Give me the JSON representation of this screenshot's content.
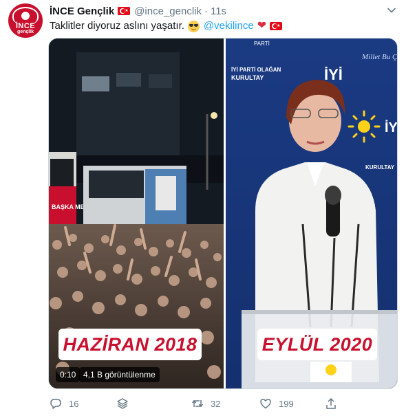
{
  "account": {
    "display_name": "İNCE Gençlik",
    "handle": "@ince_genclik",
    "separator": "·",
    "time": "11s",
    "avatar_text_1": "İNCE",
    "avatar_text_2": "gençlik"
  },
  "tweet": {
    "text_before": "Taklitler diyoruz aslını yaşatır.",
    "mention": "@vekilince",
    "emojis": [
      "cool-face-emoji",
      "red-heart-emoji",
      "turkey-flag-emoji"
    ]
  },
  "media": {
    "left_caption": "HAZİRAN 2018",
    "right_caption": "EYLÜL 2020",
    "video_time": "0:10",
    "view_count": "4,1 B görüntülenme",
    "banner_texts": {
      "parti": "PARTİ",
      "iyi": "İYİ",
      "iyi_parti_olagan": "İYİ PARTİ OLAĞAN",
      "kurultay": "KURULTAY",
      "slogan": "Millet Bu Çağrıyor",
      "bus_text": "BAŞKA MEMLEKET"
    }
  },
  "actions": {
    "reply_count": "16",
    "retweet_count": "32",
    "like_count": "199"
  },
  "colors": {
    "accent": "#1da1f2",
    "caption_red": "#c8102e",
    "muted": "#657786",
    "banner_blue": "#1c3f8a",
    "sun_yellow": "#ffd21a"
  }
}
